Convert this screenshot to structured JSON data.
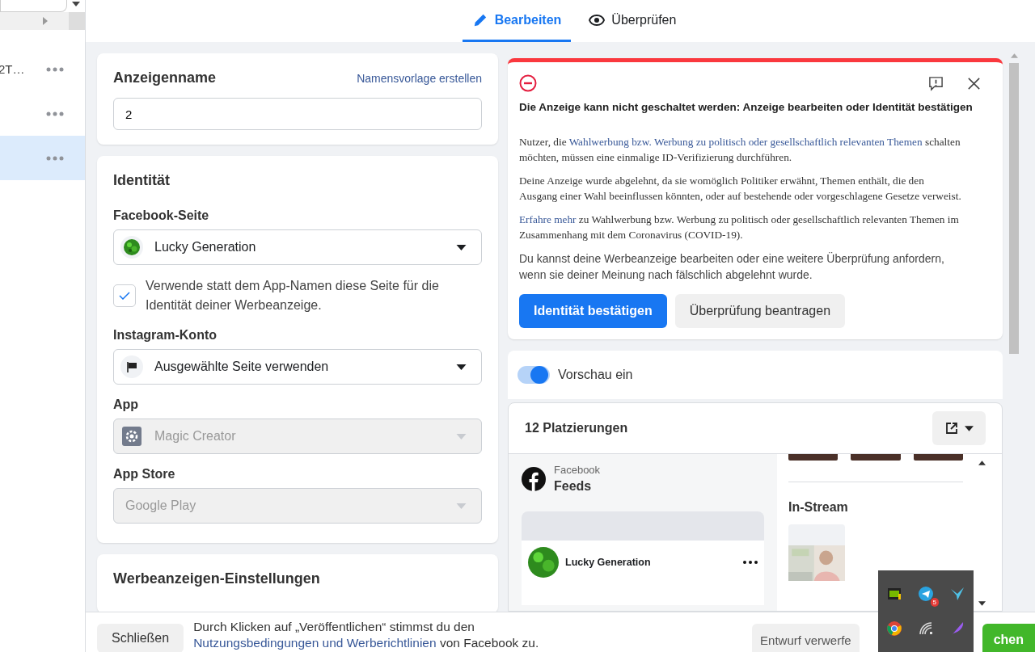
{
  "sidebar": {
    "items": [
      {
        "label": "2T…",
        "selected": false
      },
      {
        "selected": false
      },
      {
        "selected": true
      }
    ]
  },
  "tabs": [
    {
      "kind": "edit",
      "label": "Bearbeiten",
      "selected": true
    },
    {
      "kind": "review",
      "label": "Überprüfen",
      "selected": false
    }
  ],
  "ad_name": {
    "title": "Anzeigenname",
    "link": "Namensvorlage erstellen",
    "value": "2"
  },
  "identity": {
    "title": "Identität",
    "fields": [
      {
        "kind": "select",
        "label": "Facebook-Seite",
        "value": "Lucky Generation",
        "disabled": false
      },
      {
        "kind": "checkbox",
        "label": "Verwende statt dem App-Namen diese Seite für die Identität deiner Werbeanzeige.",
        "checked": true
      },
      {
        "kind": "select",
        "label": "Instagram-Konto",
        "value": "Ausgewählte Seite verwenden",
        "disabled": false
      },
      {
        "kind": "select",
        "label": "App",
        "value": "Magic Creator",
        "disabled": true
      },
      {
        "kind": "select",
        "label": "App Store",
        "value": "Google Play",
        "disabled": true
      }
    ]
  },
  "settings": {
    "title": "Werbeanzeigen-Einstellungen"
  },
  "alert": {
    "title": "Die Anzeige kann nicht geschaltet werden: Anzeige bearbeiten oder Identität bestätigen",
    "paragraphs": [
      {
        "before": "Nutzer, die ",
        "link": "Wahlwerbung bzw. Werbung zu politisch oder gesellschaftlich relevanten Themen",
        "after": " schalten möchten, müssen eine einmalige ID-Verifizierung durchführen."
      },
      {
        "before": "Deine Anzeige wurde abgelehnt, da sie womöglich Politiker erwähnt, Themen enthält, die den Ausgang einer Wahl beeinflussen könnten, oder auf bestehende oder vorgeschlagene Gesetze verweist."
      },
      {
        "link": "Erfahre mehr",
        "after": " zu Wahlwerbung bzw. Werbung zu politisch oder gesellschaftlich relevanten Themen im Zusammenhang mit dem Coronavirus (COVID-19)."
      },
      {
        "before": "Du kannst deine Werbeanzeige bearbeiten oder eine weitere Überprüfung anfordern, wenn sie deiner Meinung nach fälschlich abgelehnt wurde."
      }
    ],
    "primary": "Identität bestätigen",
    "secondary": "Überprüfung beantragen"
  },
  "preview": {
    "label": "Vorschau ein",
    "on": true
  },
  "placements": {
    "title": "12 Platzierungen",
    "platform": "Facebook",
    "feed": "Feeds",
    "page": "Lucky Generation",
    "section": "In-Stream"
  },
  "footer": {
    "close": "Schließen",
    "terms": {
      "before": "Durch Klicken auf „Veröffentlichen“ stimmst du den ",
      "link": "Nutzungsbedingungen und Werberichtlinien",
      "after": " von Facebook zu."
    },
    "discard": "Entwurf verwerfe",
    "publish": "chen"
  },
  "tray": {
    "badge": "5"
  }
}
